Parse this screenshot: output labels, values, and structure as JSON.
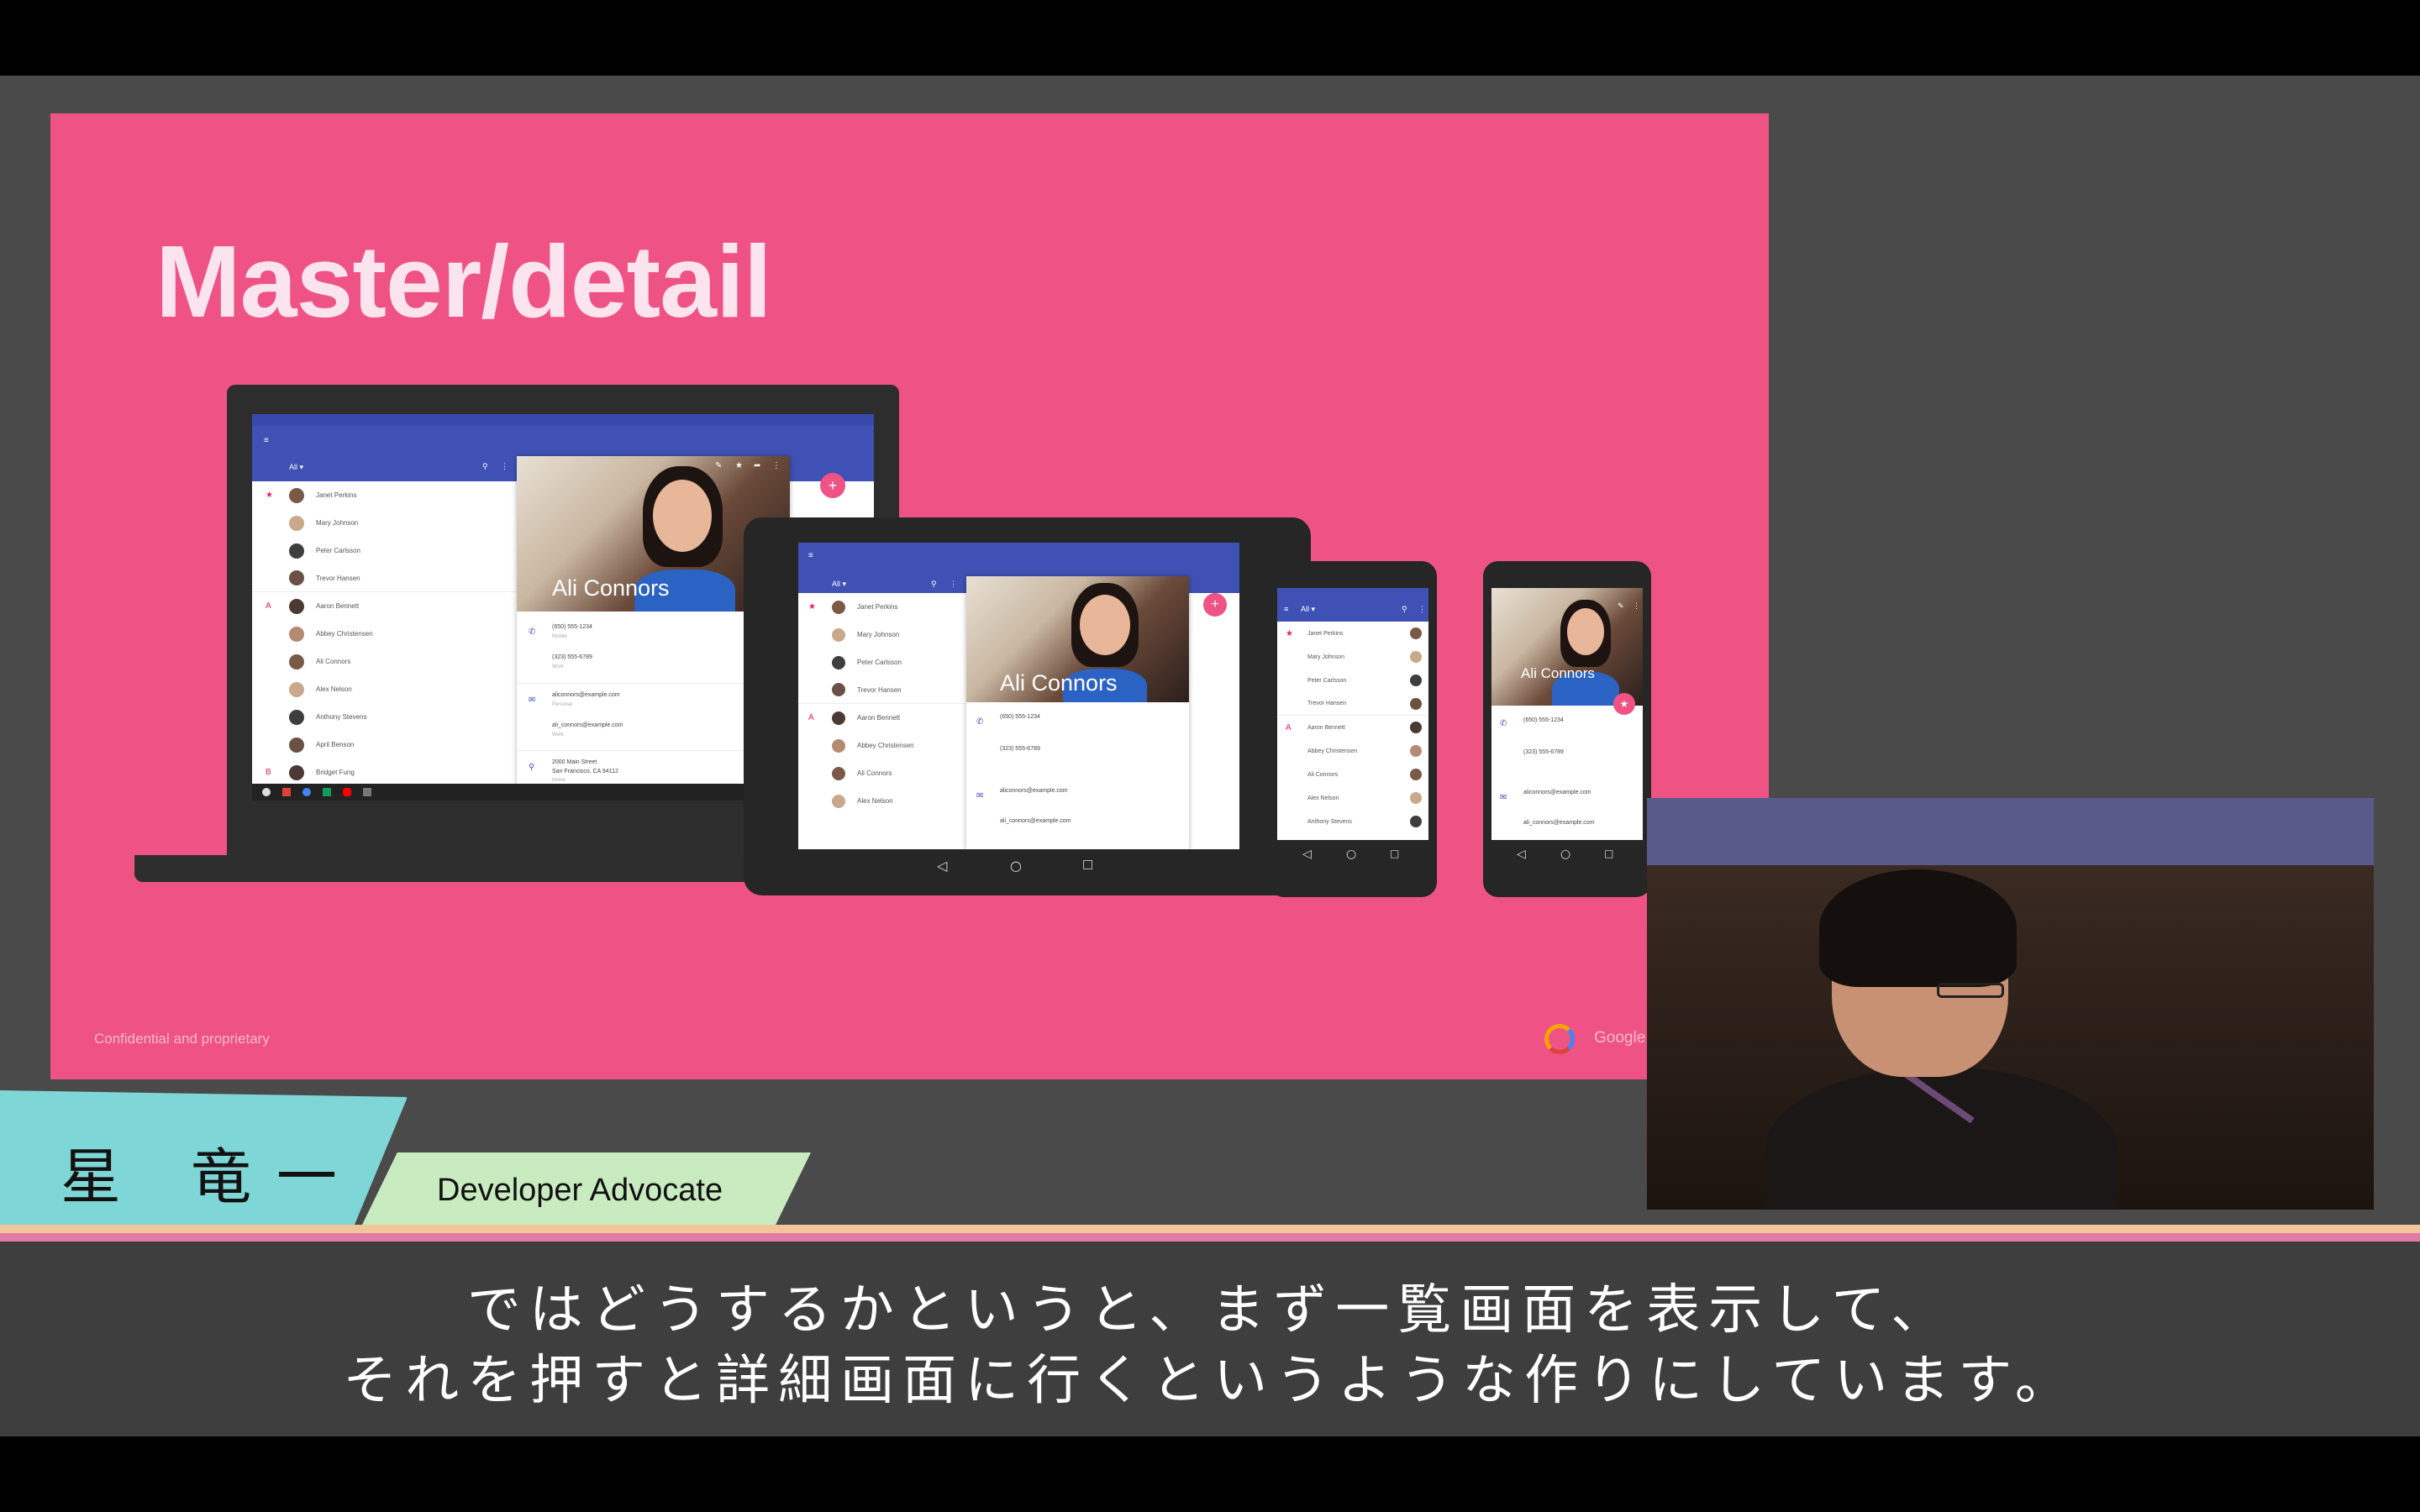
{
  "slide": {
    "title": "Master/detail",
    "footer_left": "Confidential and proprietary",
    "footer_right": "Google I/O"
  },
  "laptop_app": {
    "filter": "All ▾",
    "contacts": [
      {
        "letter": "★",
        "name": "Janet Perkins"
      },
      {
        "letter": "",
        "name": "Mary Johnson"
      },
      {
        "letter": "",
        "name": "Peter Carlsson"
      },
      {
        "letter": "",
        "name": "Trevor Hansen"
      },
      {
        "letter": "A",
        "name": "Aaron Bennett"
      },
      {
        "letter": "",
        "name": "Abbey Christensen"
      },
      {
        "letter": "",
        "name": "Ali Connors"
      },
      {
        "letter": "",
        "name": "Alex Nelson"
      },
      {
        "letter": "",
        "name": "Anthony Stevens"
      },
      {
        "letter": "",
        "name": "April Benson"
      },
      {
        "letter": "B",
        "name": "Bridget Fung"
      }
    ],
    "detail": {
      "name": "Ali Connors",
      "phone1": "(650) 555-1234",
      "phone1_type": "Mobile",
      "phone2": "(323) 555-6789",
      "phone2_type": "Work",
      "email1": "aliconnors@example.com",
      "email1_type": "Personal",
      "email2": "ali_connors@example.com",
      "email2_type": "Work",
      "address1": "2000 Main Street",
      "address2": "San Francisco, CA 94112",
      "address_type": "Home"
    }
  },
  "tablet_app": {
    "filter": "All ▾",
    "contacts": [
      {
        "letter": "★",
        "name": "Janet Perkins"
      },
      {
        "letter": "",
        "name": "Mary Johnson"
      },
      {
        "letter": "",
        "name": "Peter Carlsson"
      },
      {
        "letter": "",
        "name": "Trevor Hansen"
      },
      {
        "letter": "A",
        "name": "Aaron Bennett"
      },
      {
        "letter": "",
        "name": "Abbey Christensen"
      },
      {
        "letter": "",
        "name": "Ali Connors"
      },
      {
        "letter": "",
        "name": "Alex Nelson"
      }
    ],
    "detail_name": "Ali Connors"
  },
  "phone1_app": {
    "filter": "All ▾",
    "contacts": [
      {
        "letter": "★",
        "name": "Janet Perkins"
      },
      {
        "letter": "",
        "name": "Mary Johnson"
      },
      {
        "letter": "",
        "name": "Peter Carlsson"
      },
      {
        "letter": "",
        "name": "Trevor Hansen"
      },
      {
        "letter": "A",
        "name": "Aaron Bennett"
      },
      {
        "letter": "",
        "name": "Abbey Christensen"
      },
      {
        "letter": "",
        "name": "Ali Connors"
      },
      {
        "letter": "",
        "name": "Alex Nelson"
      },
      {
        "letter": "",
        "name": "Anthony Stevens"
      }
    ]
  },
  "phone2_app": {
    "detail_name": "Ali Connors"
  },
  "nav": {
    "back": "◁",
    "home": "○",
    "recent": "□"
  },
  "lower_third": {
    "name": "星 竜一",
    "role": "Developer Advocate"
  },
  "subtitles": {
    "line1": "ではどうするかというと、まず一覧画面を表示して、",
    "line2": "それを押すと詳細画面に行くというような作りにしています。"
  },
  "colors": {
    "slide_bg": "#ef5385",
    "app_bar": "#3f51b5",
    "fab": "#ef5385",
    "name_plate": "#7fd6d7",
    "role_plate": "#c8ebc0"
  },
  "icons": [
    "menu-icon",
    "search-icon",
    "more-icon",
    "edit-icon",
    "star-icon",
    "share-icon",
    "phone-icon",
    "email-icon",
    "location-icon",
    "add-icon"
  ]
}
